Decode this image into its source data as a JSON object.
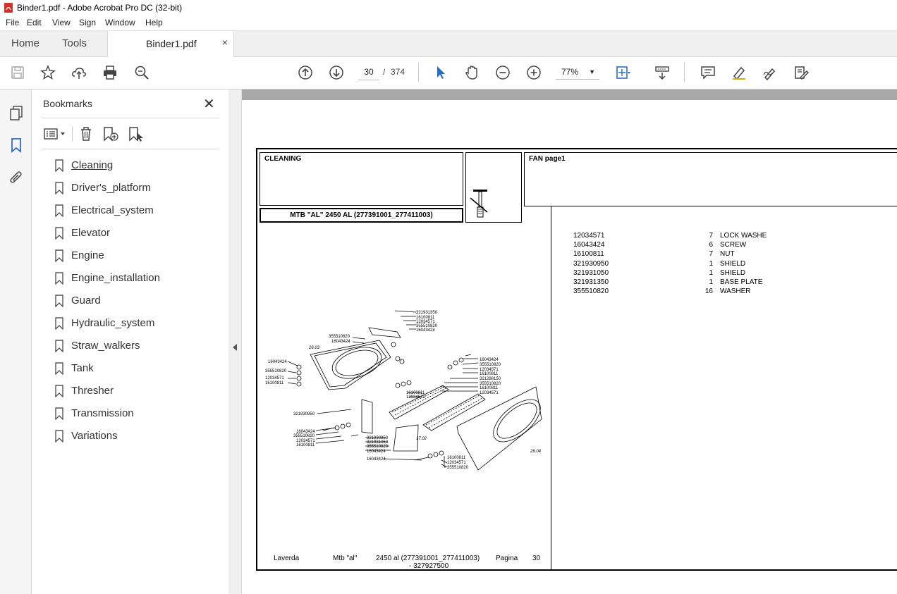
{
  "window": {
    "title": "Binder1.pdf - Adobe Acrobat Pro DC (32-bit)"
  },
  "menu": [
    "File",
    "Edit",
    "View",
    "Sign",
    "Window",
    "Help"
  ],
  "tabs": {
    "home": "Home",
    "tools": "Tools",
    "document": "Binder1.pdf",
    "close": "×"
  },
  "toolbar": {
    "current_page": "30",
    "page_sep": "/",
    "total_pages": "374",
    "zoom": "77%"
  },
  "sidebar": {
    "title": "Bookmarks",
    "close": "✕",
    "items": [
      "Cleaning",
      "Driver's_platform",
      "Electrical_system",
      "Elevator",
      "Engine",
      "Engine_installation",
      "Guard",
      "Hydraulic_system",
      "Straw_walkers",
      "Tank",
      "Thresher",
      "Transmission",
      "Variations"
    ]
  },
  "pdf": {
    "section": "CLEANING",
    "model": "MTB \"AL\" 2450 AL (277391001_277411003)",
    "group": "FAN page1",
    "parts": [
      {
        "code": "12034571",
        "qty": "7",
        "desc": "LOCK WASHE"
      },
      {
        "code": "16043424",
        "qty": "6",
        "desc": "SCREW"
      },
      {
        "code": "16100811",
        "qty": "7",
        "desc": "NUT"
      },
      {
        "code": "321930950",
        "qty": "1",
        "desc": "SHIELD"
      },
      {
        "code": "321931050",
        "qty": "1",
        "desc": "SHIELD"
      },
      {
        "code": "321931350",
        "qty": "1",
        "desc": "BASE PLATE"
      },
      {
        "code": "355510820",
        "qty": "16",
        "desc": "WASHER"
      }
    ],
    "diagram_labels": [
      "321931350",
      "16100811",
      "12034571",
      "355510820",
      "16043424",
      "355510820",
      "16043424",
      "26.03",
      "16043424",
      "355510820",
      "12034571",
      "16100811",
      "16043424",
      "355510820",
      "12034571",
      "16100811",
      "321288150",
      "355510820",
      "16100811",
      "12034571",
      "16100811",
      "12034571",
      "321930950",
      "16043424",
      "355510820",
      "12034571",
      "16100811",
      "321930950",
      "321931050",
      "355510820",
      "16043424",
      "17.02",
      "16043424",
      "16100811",
      "12034571",
      "355510820",
      "26.04"
    ],
    "footer": {
      "brand": "Laverda",
      "model": "Mtb \"al\"",
      "variant": "2450 al (277391001_277411003)",
      "variant2": "- 327927500",
      "page_label": "Pagina",
      "page_num": "30"
    }
  },
  "colors": {
    "accent": "#2c6cc4",
    "pdf_icon": "#d4302c"
  }
}
